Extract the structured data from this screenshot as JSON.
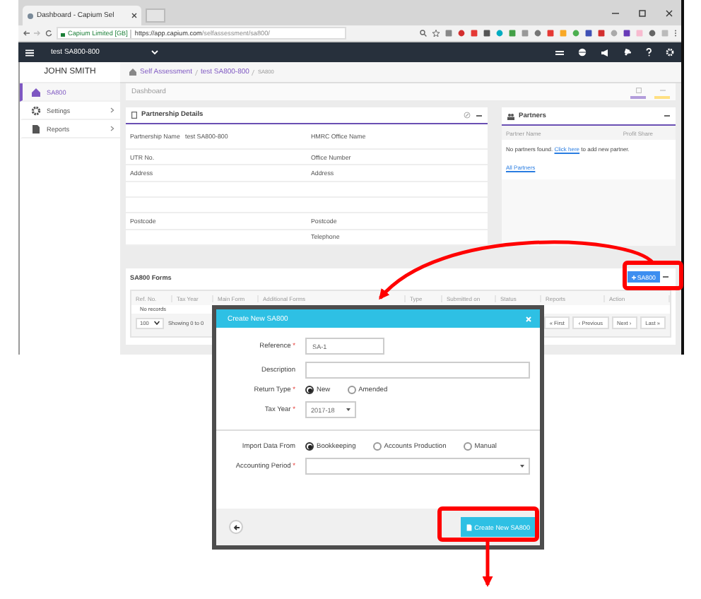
{
  "browser": {
    "tab_title": "Dashboard - Capium Sel",
    "site": "Capium Limited [GB]",
    "url_host": "https://app.capium.com",
    "url_path": "/selfassessment/sa800/"
  },
  "navbar": {
    "client": "test SA800-800"
  },
  "sidebar": {
    "user": "JOHN SMITH",
    "items": [
      {
        "label": "SA800",
        "selected": true,
        "has_submenu": false
      },
      {
        "label": "Settings",
        "selected": false,
        "has_submenu": true
      },
      {
        "label": "Reports",
        "selected": false,
        "has_submenu": true
      }
    ]
  },
  "breadcrumb": [
    "Self Assessment",
    "test SA800-800",
    "SA800"
  ],
  "page_title": "Dashboard",
  "partnership_details": {
    "title": "Partnership Details",
    "rows": [
      {
        "kind": "field",
        "label": "Partnership Name",
        "value": "test SA800-800",
        "label_2": "HMRC Office Name"
      },
      {
        "kind": "field",
        "label": "UTR No.",
        "label_2": "Office Number"
      },
      {
        "kind": "field",
        "label": "Address",
        "label_2": "Address"
      },
      {
        "kind": "blank"
      },
      {
        "kind": "blank"
      },
      {
        "kind": "field",
        "label": "Postcode",
        "label_2": "Postcode"
      },
      {
        "kind": "field",
        "label_2": "Telephone"
      }
    ]
  },
  "partners": {
    "title": "Partners",
    "columns": [
      "Partner Name",
      "Profit Share"
    ],
    "message": "No partners found.",
    "link": "Click here",
    "message_end": "to add new partner.",
    "all_link": "All Partners"
  },
  "forms": {
    "title": "SA800 Forms",
    "add_button": "SA800",
    "columns": [
      "Ref. No.",
      "Tax Year",
      "Main Form",
      "Additional Forms",
      "Type",
      "Submitted on",
      "Status",
      "Reports",
      "Action"
    ],
    "empty": "No records",
    "page_size": "100",
    "showing": "Showing 0 to 0",
    "pager": [
      "« First",
      "‹ Previous",
      "Next ›",
      "Last »"
    ]
  },
  "modal": {
    "title": "Create New SA800",
    "sections": [
      [
        {
          "kind": "text",
          "label": "Reference",
          "required_mark": "*",
          "value": "SA-1"
        },
        {
          "kind": "text",
          "label": "Description"
        },
        {
          "kind": "radio",
          "label": "Return Type",
          "required_mark": "*",
          "options": [
            {
              "label": "New",
              "selected": true
            },
            {
              "label": "Amended",
              "selected": false
            }
          ]
        },
        {
          "kind": "select",
          "label": "Tax Year",
          "required_mark": "*",
          "value": "2017-18"
        }
      ],
      [
        {
          "kind": "radio",
          "label": "Import Data From",
          "options": [
            {
              "label": "Bookkeeping",
              "selected": true
            },
            {
              "label": "Accounts Production",
              "selected": false
            },
            {
              "label": "Manual",
              "selected": false
            }
          ]
        },
        {
          "kind": "combo",
          "label": "Accounting Period",
          "required_mark": "*"
        }
      ]
    ],
    "submit": "Create New SA800"
  }
}
